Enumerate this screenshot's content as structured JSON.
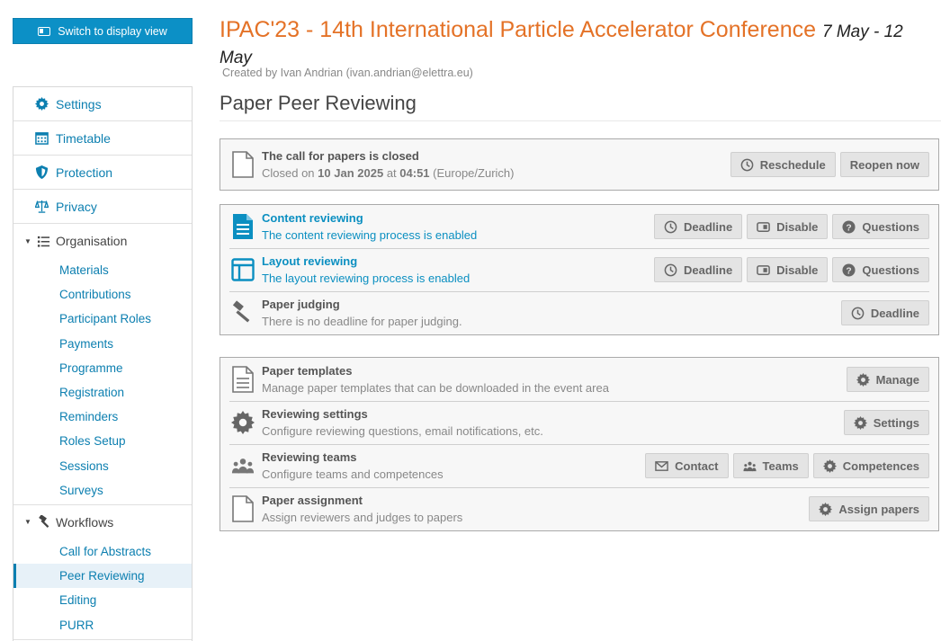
{
  "switch_button": {
    "label": "Switch to display view",
    "icon": "display-icon"
  },
  "header": {
    "title": "IPAC'23 - 14th International Particle Accelerator Conference",
    "dates": "7 May - 12 May",
    "created_by": "Created by Ivan Andrian (ivan.andrian@elettra.eu)",
    "page_title": "Paper Peer Reviewing"
  },
  "sidebar": {
    "items": [
      {
        "label": "Settings",
        "icon": "gear-icon"
      },
      {
        "label": "Timetable",
        "icon": "calendar-icon"
      },
      {
        "label": "Protection",
        "icon": "shield-icon"
      },
      {
        "label": "Privacy",
        "icon": "scales-icon"
      }
    ],
    "organisation": {
      "label": "Organisation",
      "icon": "list-icon",
      "items": [
        "Materials",
        "Contributions",
        "Participant Roles",
        "Payments",
        "Programme",
        "Registration",
        "Reminders",
        "Roles Setup",
        "Sessions",
        "Surveys"
      ]
    },
    "workflows": {
      "label": "Workflows",
      "icon": "hammer-icon",
      "items": [
        "Call for Abstracts",
        "Peer Reviewing",
        "Editing",
        "PURR"
      ],
      "active": "Peer Reviewing"
    }
  },
  "cfp": {
    "title": "The call for papers is closed",
    "closed_prefix": "Closed on",
    "closed_date": "10 Jan 2025",
    "closed_at": "at",
    "closed_time": "04:51",
    "closed_tz": "(Europe/Zurich)",
    "reschedule": "Reschedule",
    "reopen": "Reopen now"
  },
  "reviewing": {
    "content": {
      "title": "Content reviewing",
      "desc": "The content reviewing process is enabled",
      "deadline": "Deadline",
      "disable": "Disable",
      "questions": "Questions"
    },
    "layout": {
      "title": "Layout reviewing",
      "desc": "The layout reviewing process is enabled",
      "deadline": "Deadline",
      "disable": "Disable",
      "questions": "Questions"
    },
    "judging": {
      "title": "Paper judging",
      "desc": "There is no deadline for paper judging.",
      "deadline": "Deadline"
    }
  },
  "management": {
    "templates": {
      "title": "Paper templates",
      "desc": "Manage paper templates that can be downloaded in the event area",
      "manage": "Manage"
    },
    "settings": {
      "title": "Reviewing settings",
      "desc": "Configure reviewing questions, email notifications, etc.",
      "settings": "Settings"
    },
    "teams": {
      "title": "Reviewing teams",
      "desc": "Configure teams and competences",
      "contact": "Contact",
      "teams": "Teams",
      "competences": "Competences"
    },
    "assignment": {
      "title": "Paper assignment",
      "desc": "Assign reviewers and judges to papers",
      "assign": "Assign papers"
    }
  },
  "colors": {
    "accent": "#0c90c6",
    "title_orange": "#e47227",
    "link_blue": "#0c7fb0"
  }
}
